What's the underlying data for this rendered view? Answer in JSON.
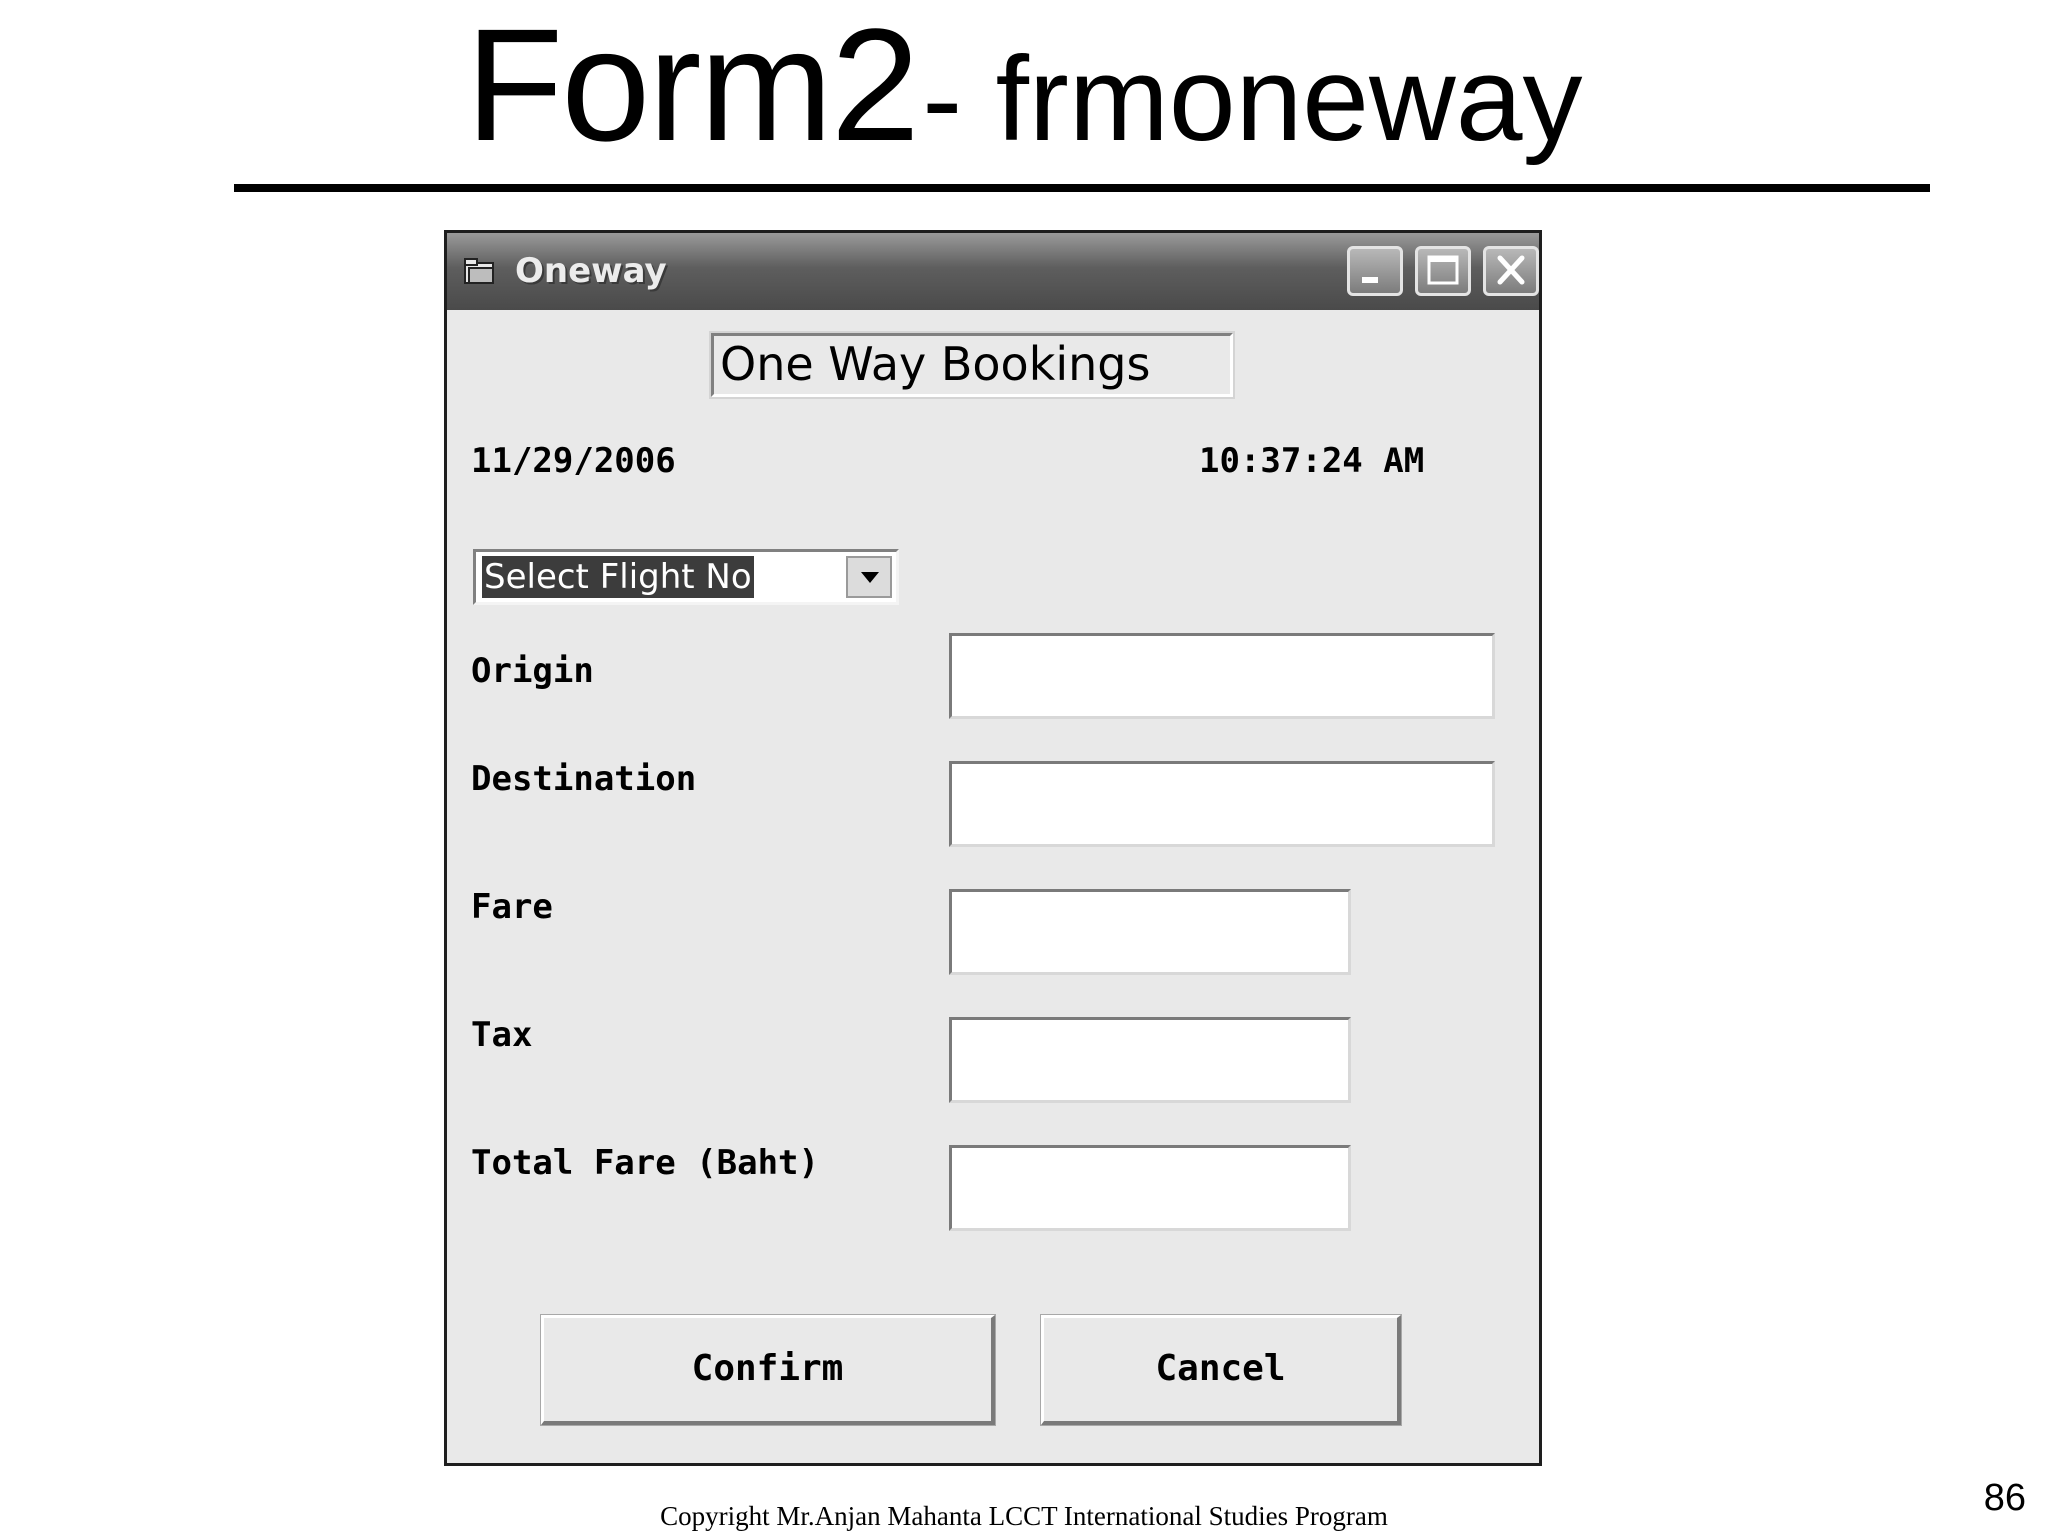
{
  "slide": {
    "title_main": "Form2",
    "title_sub": "- frmoneway",
    "copyright": "Copyright Mr.Anjan Mahanta LCCT International Studies Program",
    "page_number": "86"
  },
  "window": {
    "title": "Oneway",
    "icon": "folder-icon",
    "controls": [
      "minimize-icon",
      "maximize-icon",
      "close-icon"
    ]
  },
  "form": {
    "heading": "One Way Bookings",
    "date": "11/29/2006",
    "time": "10:37:24 AM",
    "flight_combo": {
      "selected": "Select Flight No"
    },
    "fields": [
      {
        "label": "Origin",
        "value": ""
      },
      {
        "label": "Destination",
        "value": ""
      },
      {
        "label": "Fare",
        "value": ""
      },
      {
        "label": "Tax",
        "value": ""
      },
      {
        "label": "Total Fare (Baht)",
        "value": ""
      }
    ],
    "buttons": {
      "confirm": "Confirm",
      "cancel": "Cancel"
    }
  },
  "colors": {
    "titlebar": "#5e5e5e",
    "form_background": "#e9e9e9",
    "selection_highlight": "#3c3c3c"
  }
}
